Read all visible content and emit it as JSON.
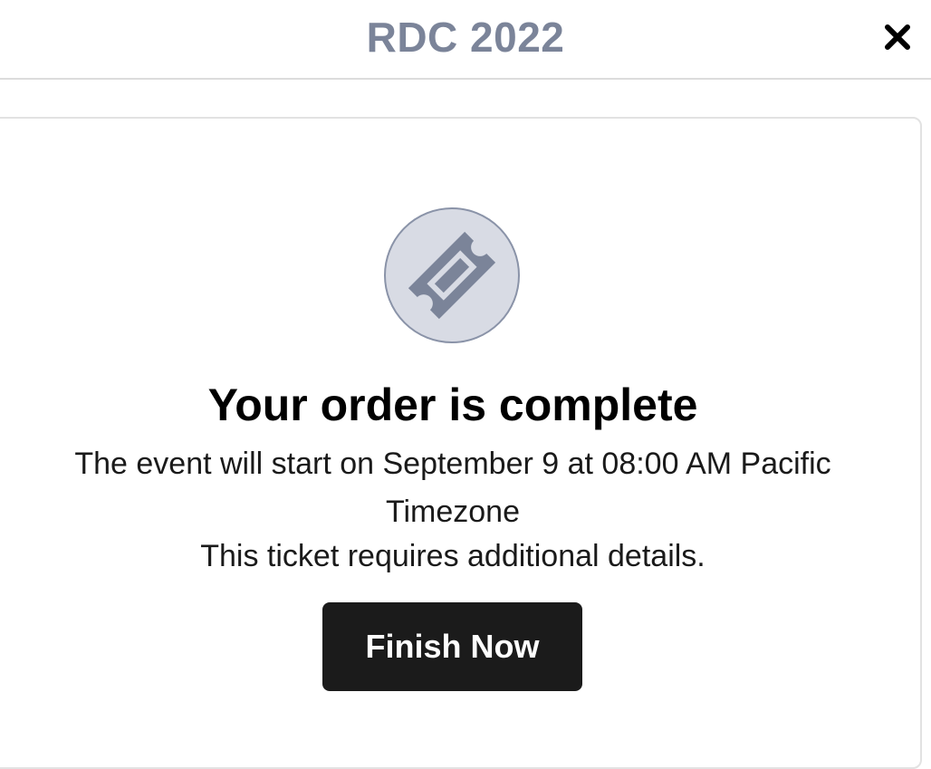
{
  "header": {
    "title": "RDC 2022",
    "close_icon": "close-icon"
  },
  "confirmation": {
    "icon": "ticket-icon",
    "title": "Your order is complete",
    "event_text": "The event will start on September 9 at 08:00 AM Pacific Timezone",
    "details_text": "This ticket requires additional details.",
    "button_label": "Finish Now"
  },
  "colors": {
    "title_gray": "#7b8499",
    "icon_circle_fill": "#d8dbe4",
    "icon_fill": "#7b8499",
    "button_bg": "#1b1b1b",
    "button_text": "#ffffff"
  }
}
